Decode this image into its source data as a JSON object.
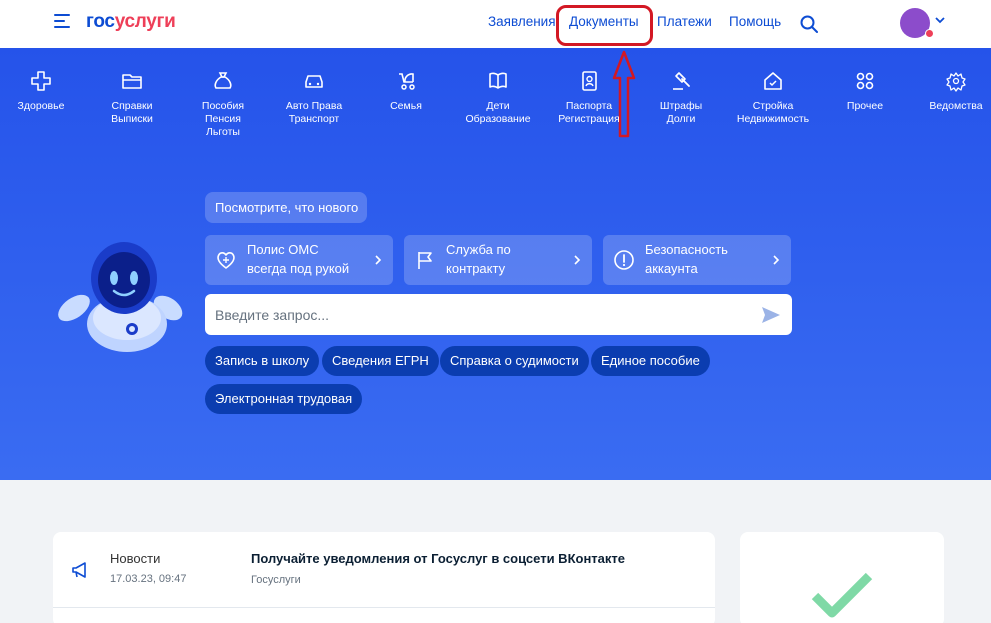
{
  "header": {
    "logo_part1": "гос",
    "logo_part2": "услуги",
    "nav": [
      "Заявления",
      "Документы",
      "Платежи",
      "Помощь"
    ]
  },
  "categories": [
    {
      "label": "Здоровье",
      "icon": "health-icon"
    },
    {
      "label": "Справки\nВыписки",
      "icon": "folder-icon"
    },
    {
      "label": "Пособия\nПенсия\nЛьготы",
      "icon": "money-bag-icon"
    },
    {
      "label": "Авто Права\nТранспорт",
      "icon": "car-icon"
    },
    {
      "label": "Семья",
      "icon": "stroller-icon"
    },
    {
      "label": "Дети\nОбразование",
      "icon": "book-icon"
    },
    {
      "label": "Паспорта\nРегистрация",
      "icon": "passport-icon"
    },
    {
      "label": "Штрафы\nДолги",
      "icon": "gavel-icon"
    },
    {
      "label": "Стройка\nНедвижимость",
      "icon": "house-icon"
    },
    {
      "label": "Прочее",
      "icon": "grid-icon"
    },
    {
      "label": "Ведомства",
      "icon": "emblem-icon"
    }
  ],
  "hero": {
    "news_pill": "Посмотрите, что нового",
    "cards": [
      {
        "line1": "Полис ОМС",
        "line2": "всегда под рукой",
        "icon": "heart-icon"
      },
      {
        "line1": "Служба по",
        "line2": "контракту",
        "icon": "flag-icon"
      },
      {
        "line1": "Безопасность",
        "line2": "аккаунта",
        "icon": "alert-icon"
      }
    ],
    "search_placeholder": "Введите запрос...",
    "chips": [
      "Запись в школу",
      "Сведения ЕГРН",
      "Справка о судимости",
      "Единое пособие",
      "Электронная трудовая"
    ]
  },
  "news": {
    "category": "Новости",
    "date": "17.03.23, 09:47",
    "title": "Получайте уведомления от Госуслуг в соцсети ВКонтакте",
    "source": "Госуслуги"
  },
  "colors": {
    "brand_blue": "#0d4cd3",
    "brand_red": "#ee3f58",
    "hero_blue": "#2553ea",
    "chip_blue": "#0b3db0",
    "annotation_red": "#d31824",
    "check_green": "#7fd9a6"
  }
}
